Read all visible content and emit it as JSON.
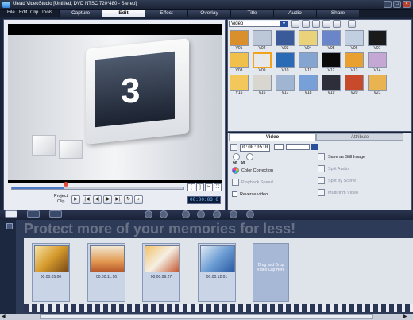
{
  "app": {
    "title": "Ulead VideoStudio [Untitled, DVD NTSC 720*480 - Stereo]"
  },
  "menu": [
    "File",
    "Edit",
    "Clip",
    "Tools"
  ],
  "steps": [
    {
      "label": "Capture",
      "active": false
    },
    {
      "label": "Edit",
      "active": true
    },
    {
      "label": "Effect",
      "active": false
    },
    {
      "label": "Overlay",
      "active": false
    },
    {
      "label": "Title",
      "active": false
    },
    {
      "label": "Audio",
      "active": false
    },
    {
      "label": "Share",
      "active": false
    }
  ],
  "preview": {
    "countdown": "3",
    "mode_label": "Project",
    "mode_sub": "Clip",
    "timecode": "00:00:03:0",
    "progress": 0.3
  },
  "library": {
    "category": "Video",
    "thumbs": [
      "V01",
      "V02",
      "V03",
      "V04",
      "V05",
      "V06",
      "V07",
      "V08",
      "V09",
      "V10",
      "V11",
      "V12",
      "V13",
      "V14",
      "V15",
      "V16",
      "V17",
      "V18",
      "V19",
      "V20",
      "V21"
    ],
    "selected": "V09",
    "colors": [
      "#d98f2c",
      "#bcc7d8",
      "#3a5a9a",
      "#e9d27a",
      "#6a86c8",
      "#c2cfe0",
      "#1a1a1a",
      "#f0c04a",
      "#e8e8e8",
      "#2b6bb5",
      "#86a4d0",
      "#0a0a0a",
      "#e8a030",
      "#c4a7d2",
      "#f3c85a",
      "#d9d5cf",
      "#9fb5d2",
      "#78a0d8",
      "#2e2e3a",
      "#c74a2a",
      "#e9b450"
    ]
  },
  "options": {
    "tabs": {
      "video": "Video",
      "attribute": "Attribute"
    },
    "duration": "0:00:05:0",
    "color_correction": "Color Correction",
    "playback_speed": "Playback Speed",
    "reverse_video": "Reverse video",
    "save_still": "Save as Still Image",
    "split_audio": "Split Audio",
    "split_scene": "Split by Scene",
    "multitrim": "Multi-trim Video"
  },
  "timeline": {
    "promo": "Protect more of your memories for less!",
    "clips": [
      {
        "time": "00:00:05:00"
      },
      {
        "time": "00:00:11:16"
      },
      {
        "time": "00:00:09:27"
      },
      {
        "time": "00:00:12:01"
      }
    ],
    "dropzone": "Drag and Drop Video Clip Here"
  }
}
